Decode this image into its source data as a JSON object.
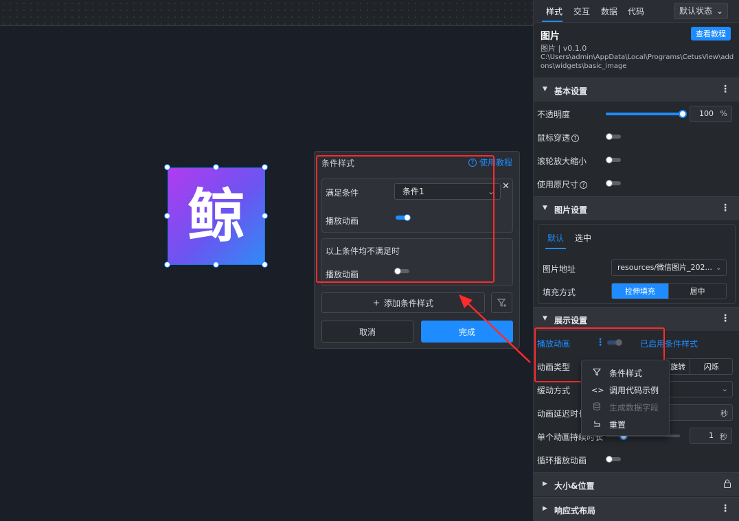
{
  "canvas": {
    "image_text": "鲸"
  },
  "condition_popup": {
    "title": "条件样式",
    "help_link": "使用教程",
    "rule1": {
      "cond_label": "满足条件",
      "cond_value": "条件1",
      "anim_label": "播放动画",
      "anim_on": true
    },
    "rule_else": {
      "title": "以上条件均不满足时",
      "anim_label": "播放动画",
      "anim_on": false
    },
    "add_label": "添加条件样式",
    "cancel_label": "取消",
    "done_label": "完成"
  },
  "panel": {
    "tabs": [
      "样式",
      "交互",
      "数据",
      "代码"
    ],
    "state_select": "默认状态",
    "widget_title": "图片",
    "widget_version": "图片 | v0.1.0",
    "widget_path": "C:\\Users\\admin\\AppData\\Local\\Programs\\CetusView\\addons\\widgets\\basic_image",
    "tutorial_button": "查看教程",
    "basic": {
      "title": "基本设置",
      "opacity_label": "不透明度",
      "opacity_value": "100",
      "opacity_unit": "%",
      "opacity_percent": 100,
      "mouse_through_label": "鼠标穿透",
      "wheel_zoom_label": "滚轮放大缩小",
      "original_size_label": "使用原尺寸"
    },
    "image": {
      "title": "图片设置",
      "sub_tabs": [
        "默认",
        "选中"
      ],
      "src_label": "图片地址",
      "src_value": "resources/微信图片_202...",
      "fill_label": "填充方式",
      "fill_options": [
        "拉伸填充",
        "居中"
      ]
    },
    "display": {
      "title": "展示设置",
      "anim_label": "播放动画",
      "anim_status": "已启用条件样式",
      "anim_type_label": "动画类型",
      "anim_type_options": [
        "旋转",
        "闪烁"
      ],
      "easing_label": "缓动方式",
      "delay_label": "动画延迟时长",
      "delay_unit": "秒",
      "duration_label": "单个动画持续时长",
      "duration_value": "1",
      "duration_unit": "秒",
      "loop_label": "循环播放动画"
    },
    "size_section": "大小&位置",
    "responsive_section": "响应式布局"
  },
  "context_menu": {
    "items": [
      {
        "label": "条件样式",
        "icon": "filter-icon",
        "disabled": false
      },
      {
        "label": "调用代码示例",
        "icon": "code-icon",
        "disabled": false
      },
      {
        "label": "生成数据字段",
        "icon": "database-icon",
        "disabled": true
      },
      {
        "label": "重置",
        "icon": "reset-icon",
        "disabled": false
      }
    ]
  },
  "colors": {
    "accent": "#1e8cff",
    "highlight": "#ff2b2b"
  }
}
